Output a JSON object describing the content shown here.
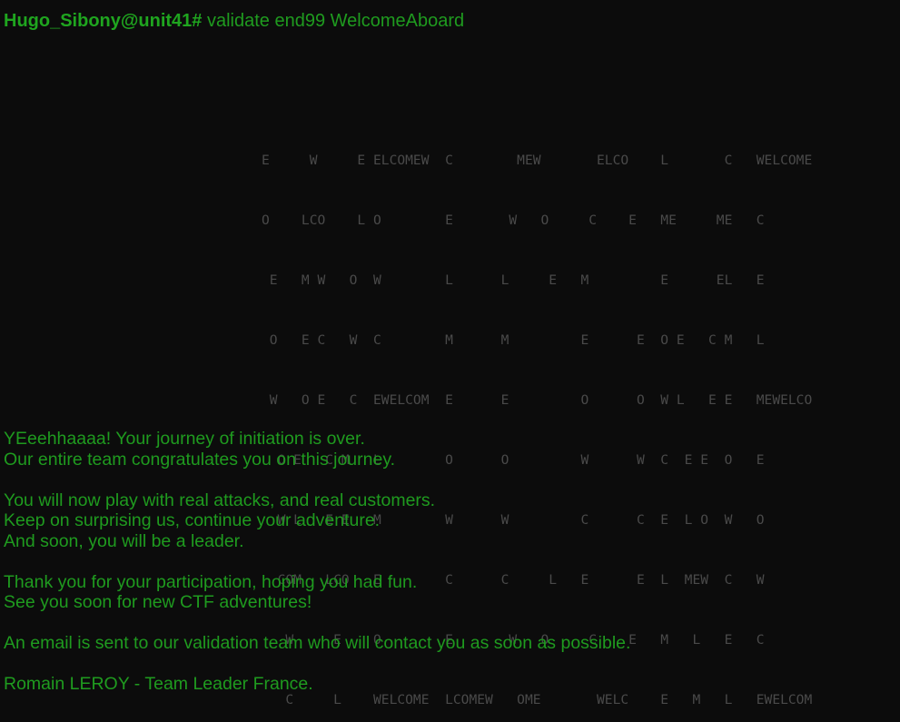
{
  "terminal": {
    "prompt_user": "Hugo_Sibony@unit41#",
    "command": "validate end99 WelcomeAboard",
    "ascii_art": [
      "E     W     E ELCOMEW  C        MEW       ELCO    L       C   WELCOME",
      "O    LCO    L O        E       W   O     C    E   ME     ME   C",
      " E   M W   O  W        L      L     E   M         E      EL   E",
      " O   E C   W  C        M      M         E      E  O E   C M   L",
      " W   O E   C  EWELCOM  E      E         O      O  W L   E E   MEWELCO",
      "  O E   C M   L        O      O         W      W  C  E E  O   E",
      "  W L   E E   M        W      W         C      C  E  L O  W   O",
      "  COM   LCO   E        C      C     L   E      E  L  MEW  C   W",
      "   W     E    O        E       W   O     C    E   M   L   E   C",
      "   C     L    WELCOME  LCOMEW   OME       WELC    E   M   L   EWELCOM"
    ],
    "message_lines": [
      "YEeehhaaaa! Your journey of initiation is over.",
      "Our entire team congratulates you on this journey.",
      "",
      "You will now play with real attacks, and real customers.",
      "Keep on surprising us, continue your adventure.",
      "And soon, you will be a leader.",
      "",
      "Thank you for your participation, hoping you had fun.",
      "See you soon for new CTF adventures!",
      "",
      "An email is sent to our validation team who will contact you as soon as possible.",
      "",
      "Romain LEROY - Team Leader France."
    ],
    "colors": {
      "background": "#0c0c0c",
      "text_green": "#1f9b1f",
      "ascii_gray": "#4a4a4a"
    }
  }
}
